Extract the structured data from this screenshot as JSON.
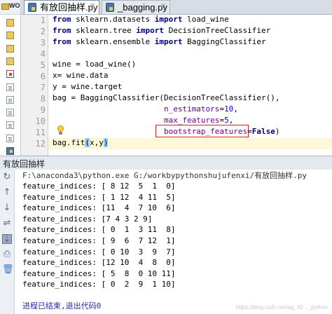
{
  "project": {
    "label": "WO"
  },
  "tabs": [
    {
      "label": "有放回抽样.py",
      "active": true
    },
    {
      "label": "_bagging.py",
      "active": false
    }
  ],
  "editor": {
    "line_numbers": [
      "1",
      "2",
      "3",
      "4",
      "5",
      "6",
      "7",
      "8",
      "9",
      "10",
      "11",
      "12"
    ],
    "current_line": 12,
    "lines": [
      {
        "parts": [
          [
            "kw",
            "from"
          ],
          [
            "t",
            " sklearn.datasets "
          ],
          [
            "kw",
            "import"
          ],
          [
            "t",
            " load_wine"
          ]
        ]
      },
      {
        "parts": [
          [
            "kw",
            "from"
          ],
          [
            "t",
            " sklearn.tree "
          ],
          [
            "kw",
            "import"
          ],
          [
            "t",
            " DecisionTreeClassifier"
          ]
        ]
      },
      {
        "parts": [
          [
            "kw",
            "from"
          ],
          [
            "t",
            " sklearn.ensemble "
          ],
          [
            "kw",
            "import"
          ],
          [
            "t",
            " BaggingClassifier"
          ]
        ]
      },
      {
        "parts": []
      },
      {
        "parts": [
          [
            "t",
            "wine = load_wine()"
          ]
        ]
      },
      {
        "parts": [
          [
            "t",
            "x= wine.data"
          ]
        ]
      },
      {
        "parts": [
          [
            "t",
            "y = wine.target"
          ]
        ]
      },
      {
        "parts": [
          [
            "t",
            "bag = BaggingClassifier(DecisionTreeClassifier(),"
          ]
        ]
      },
      {
        "parts": [
          [
            "t",
            "                        "
          ],
          [
            "param",
            "n_estimators"
          ],
          [
            "t",
            "="
          ],
          [
            "num",
            "10"
          ],
          [
            "t",
            ","
          ]
        ]
      },
      {
        "parts": [
          [
            "t",
            "                        "
          ],
          [
            "param",
            "max_features"
          ],
          [
            "t",
            "="
          ],
          [
            "num",
            "5"
          ],
          [
            "t",
            ","
          ]
        ]
      },
      {
        "parts": [
          [
            "t",
            "                        "
          ],
          [
            "param",
            "bootstrap_features"
          ],
          [
            "t",
            "="
          ],
          [
            "kw",
            "False"
          ],
          [
            "t",
            ")"
          ]
        ]
      },
      {
        "parts": [
          [
            "t",
            "bag.fit"
          ],
          [
            "hl",
            "("
          ],
          [
            "t",
            "x,y"
          ],
          [
            "hl",
            ")"
          ]
        ]
      }
    ]
  },
  "run": {
    "title": "有放回抽样",
    "command": "F:\\anaconda3\\python.exe G:/workbypythonshujufenxi/有放回抽样.py",
    "output": [
      "feature_indices: [ 8 12  5  1  0]",
      "feature_indices: [ 1 12  4 11  5]",
      "feature_indices: [11  4  7 10  6]",
      "feature_indices: [7 4 3 2 9]",
      "feature_indices: [ 0  1  3 11  8]",
      "feature_indices: [ 9  6  7 12  1]",
      "feature_indices: [ 0 10  3  9  7]",
      "feature_indices: [12 10  4  8  0]",
      "feature_indices: [ 5  8  0 10 11]",
      "feature_indices: [ 0  2  9  1 10]"
    ],
    "exit_message": "进程已结束,退出代码0",
    "watermark": "https://blog.csdn.net/qq_40..._python"
  },
  "icons": {
    "project_items": [
      "folder-icon",
      "folder-icon",
      "folder-icon",
      "folder-icon",
      "red-file-icon",
      "file-icon",
      "file-icon",
      "file-icon",
      "file-icon",
      "file-icon",
      "python-file-icon"
    ],
    "toolbar": [
      "rerun-icon",
      "scroll-up-icon",
      "scroll-down-icon",
      "soft-wrap-icon",
      "scroll-to-end-icon",
      "print-icon",
      "trash-icon"
    ]
  },
  "colors": {
    "keyword": "#000080",
    "parameter": "#660099",
    "number": "#0000ff",
    "highlight_box": "#e02020",
    "current_line": "#fdf8d8"
  }
}
